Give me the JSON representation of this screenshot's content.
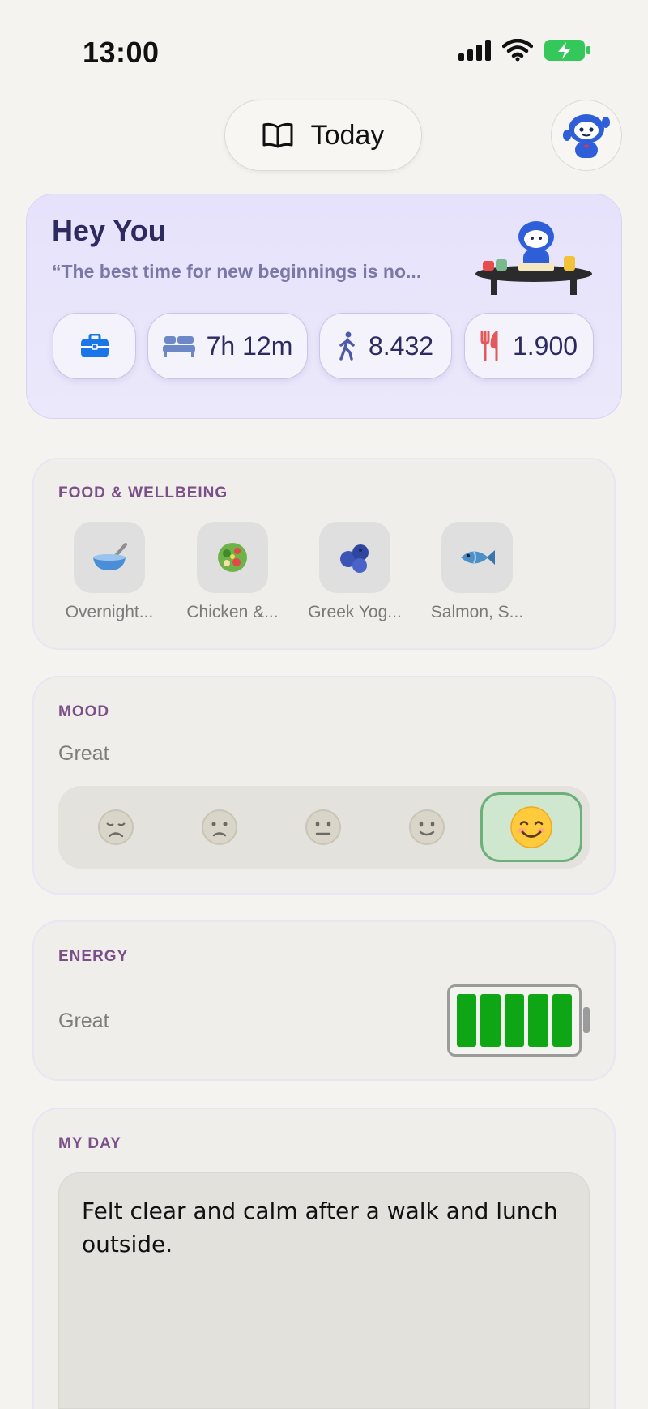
{
  "status_bar": {
    "time": "13:00"
  },
  "nav": {
    "today_label": "Today"
  },
  "hero": {
    "title": "Hey You",
    "quote": "“The best time for new beginnings is no...",
    "stats": {
      "sleep": "7h 12m",
      "steps": "8.432",
      "calories": "1.900"
    }
  },
  "food": {
    "label": "FOOD & WELLBEING",
    "items": [
      {
        "label": "Overnight...",
        "icon": "bowl-icon"
      },
      {
        "label": "Chicken &...",
        "icon": "salad-icon"
      },
      {
        "label": "Greek Yog...",
        "icon": "blueberries-icon"
      },
      {
        "label": "Salmon, S...",
        "icon": "fish-icon"
      }
    ]
  },
  "mood": {
    "label": "MOOD",
    "value": "Great",
    "selected_index": 4,
    "options": [
      "disappointed-face-icon",
      "slightly-frowning-face-icon",
      "neutral-face-icon",
      "slightly-smiling-face-icon",
      "smiling-face-icon"
    ]
  },
  "energy": {
    "label": "ENERGY",
    "value": "Great",
    "level": 5,
    "max": 5
  },
  "my_day": {
    "label": "MY DAY",
    "text": "Felt clear and calm after a walk and lunch outside."
  },
  "colors": {
    "accent_purple": "#7b4f88",
    "hero_bg": "#e6e2fb",
    "energy_green": "#0fa616",
    "mood_selected": "#6cb079"
  }
}
